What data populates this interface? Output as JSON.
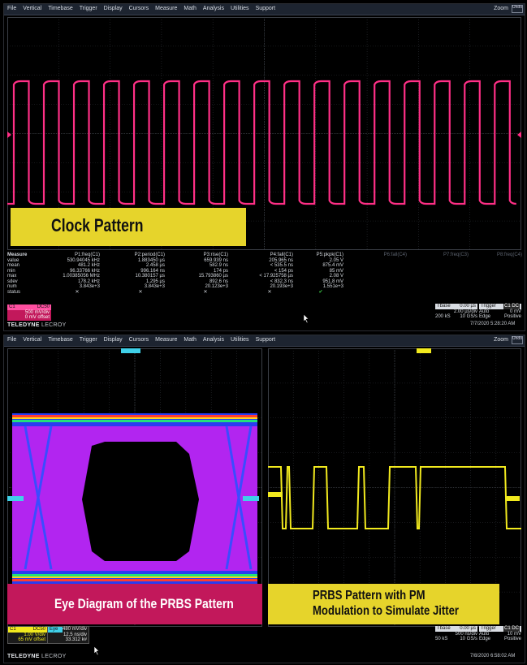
{
  "menu": [
    "File",
    "Vertical",
    "Timebase",
    "Trigger",
    "Display",
    "Cursors",
    "Measure",
    "Math",
    "Analysis",
    "Utilities",
    "Support"
  ],
  "zoom_label": "Zoom",
  "undo_label": "Undo",
  "top": {
    "banner": "Clock Pattern",
    "measure": {
      "row_labels": [
        "Measure",
        "value",
        "mean",
        "min",
        "max",
        "sdev",
        "num",
        "status"
      ],
      "columns": [
        {
          "header": "P1:freq(C1)",
          "cells": [
            "530.94045 kHz",
            "481.2 kHz",
            "96.33766 kHz",
            "1.00385056 MHz",
            "178.2 kHz",
            "3.843e+3",
            "✕"
          ]
        },
        {
          "header": "P2:period(C1)",
          "cells": [
            "1.883450 µs",
            "2.458 µs",
            "996.164 ns",
            "10.380157 µs",
            "1.295 µs",
            "3.843e+3",
            "✕"
          ]
        },
        {
          "header": "P3:rise(C1)",
          "cells": [
            "659.939 ns",
            "582.9 ns",
            "174 ps",
            "15.793860 µs",
            "892.6 ns",
            "20.123e+3",
            "✕"
          ]
        },
        {
          "header": "P4:fall(C1)",
          "cells": [
            "205.965 ns",
            "< 535.5 ns",
            "< 154 ps",
            "< 17.925758 µs",
            "< 832.3 ns",
            "20.193e+3",
            "✕"
          ]
        },
        {
          "header": "P5:pkpk(C1)",
          "cells": [
            "2.05 V",
            "875.4 mV",
            "85 mV",
            "2.08 V",
            "951.8 mV",
            "1.551e+3",
            "✔"
          ]
        },
        {
          "header": "P6:fall(C4)",
          "cells": [
            "",
            "",
            "",
            "",
            "",
            "",
            ""
          ]
        },
        {
          "header": "P7:freq(C3)",
          "cells": [
            "",
            "",
            "",
            "",
            "",
            "",
            ""
          ]
        },
        {
          "header": "P8:freq(C4)",
          "cells": [
            "",
            "",
            "",
            "",
            "",
            "",
            ""
          ]
        }
      ]
    },
    "channel": {
      "name": "C1",
      "tag": "DC50",
      "vdiv": "500 mV/div",
      "offset": "0 mV offset"
    },
    "tbase": {
      "label": "Tbase",
      "value": "0.00 µs",
      "div": "2.00 µs/div",
      "samples": "200 kS",
      "rate": "10 GS/s"
    },
    "trigger": {
      "label": "Trigger",
      "tag": "C1 DC",
      "mode": "Auto",
      "level": "0 mV",
      "type": "Edge",
      "slope": "Positive"
    },
    "brand": "TELEDYNE",
    "brand2": "LECROY",
    "timestamp": "7/7/2020 5:28:20 AM"
  },
  "bottom": {
    "banner_left": "Eye Diagram of the PRBS Pattern",
    "banner_right_line1": "PRBS Pattern with PM",
    "banner_right_line2": "Modulation to Simulate Jitter",
    "channel": {
      "name": "C1",
      "tag": "DC50",
      "vdiv": "1.00 V/div",
      "offset": "65 mV offset"
    },
    "eye": {
      "name": "Eye",
      "vdiv": "480 mV/div",
      "hdiv": "12.5 ns/div",
      "count": "33.312 k#"
    },
    "tbase": {
      "label": "Tbase",
      "value": "0.00 µs",
      "div": "500 ns/div",
      "samples": "50 kS",
      "rate": "10 GS/s"
    },
    "trigger": {
      "label": "Trigger",
      "tag": "C1 DC",
      "mode": "Auto",
      "level": "10 mV",
      "type": "Edge",
      "slope": "Positive"
    },
    "brand": "TELEDYNE",
    "brand2": "LECROY",
    "timestamp": "7/8/2020 6:58:02 AM"
  },
  "colors": {
    "trace_pink": "#ff2f86",
    "trace_yellow": "#f2ea1e",
    "banner_yellow": "#e6d42b",
    "banner_pink": "#c2185b",
    "eye_purple": "#b225f0"
  }
}
